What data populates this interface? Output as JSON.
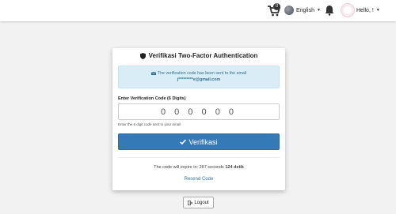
{
  "navbar": {
    "cart_count": "0",
    "language": "English",
    "user_greeting": "Hello, !"
  },
  "card": {
    "title": "Verifikasi Two-Factor Authentication",
    "alert": {
      "message": "The verification code has been sent to the email",
      "email": "j*********e@gmail.com"
    },
    "field_label": "Enter Verification Code (6 Digits)",
    "code_placeholder": "0 0 0 0 0 0",
    "help_text": "Enter the 6 digit code sent to your email",
    "verify_label": "Verifikasi",
    "expire_prefix": "The code will expire in: 287 seconds",
    "expire_remaining": "124 detik",
    "resend_label": "Resend Code"
  },
  "logout_label": "Logout",
  "colors": {
    "primary": "#337ab7",
    "alert_bg": "#d9edf7",
    "alert_text": "#31708f",
    "page_bg": "#f2f2f2"
  },
  "icons": [
    "cart-icon",
    "globe-icon",
    "bell-icon",
    "shield-icon",
    "envelope-icon",
    "check-icon",
    "logout-icon"
  ]
}
